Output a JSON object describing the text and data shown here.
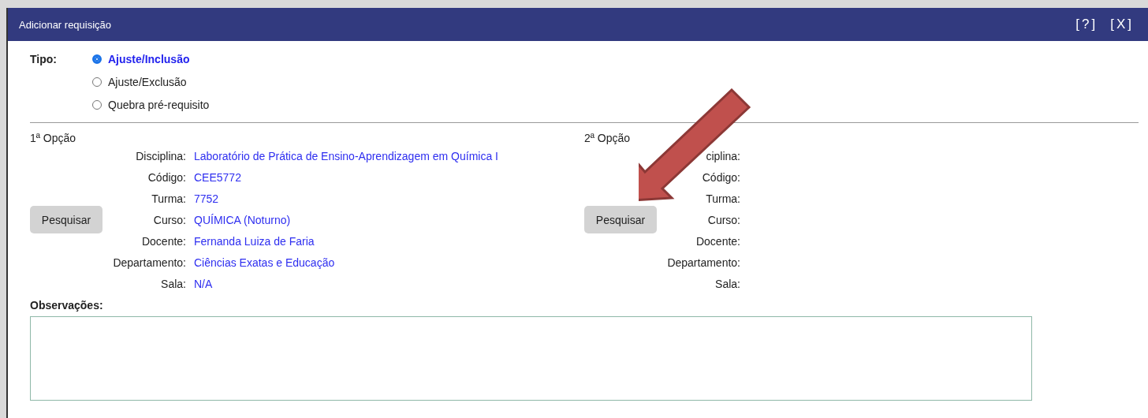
{
  "window": {
    "title": "Adicionar requisição",
    "help_label": "[?]",
    "close_label": "[X]"
  },
  "tipo": {
    "label": "Tipo:",
    "options": [
      {
        "label": "Ajuste/Inclusão",
        "selected": true
      },
      {
        "label": "Ajuste/Exclusão",
        "selected": false
      },
      {
        "label": "Quebra pré-requisito",
        "selected": false
      }
    ]
  },
  "options": [
    {
      "heading": "1ª Opção",
      "button": "Pesquisar",
      "fields": [
        {
          "label": "Disciplina:",
          "value": "Laboratório de Prática de Ensino-Aprendizagem em Química I"
        },
        {
          "label": "Código:",
          "value": "CEE5772"
        },
        {
          "label": "Turma:",
          "value": "7752"
        },
        {
          "label": "Curso:",
          "value": "QUÍMICA (Noturno)"
        },
        {
          "label": "Docente:",
          "value": "Fernanda Luiza de Faria"
        },
        {
          "label": "Departamento:",
          "value": "Ciências Exatas e Educação"
        },
        {
          "label": "Sala:",
          "value": "N/A"
        }
      ]
    },
    {
      "heading": "2ª Opção",
      "button": "Pesquisar",
      "fields": [
        {
          "label": "ciplina:"
        },
        {
          "label": "Código:"
        },
        {
          "label": "Turma:"
        },
        {
          "label": "Curso:"
        },
        {
          "label": "Docente:"
        },
        {
          "label": "Departamento:"
        },
        {
          "label": "Sala:"
        }
      ]
    }
  ],
  "observacoes": {
    "label": "Observações:"
  }
}
